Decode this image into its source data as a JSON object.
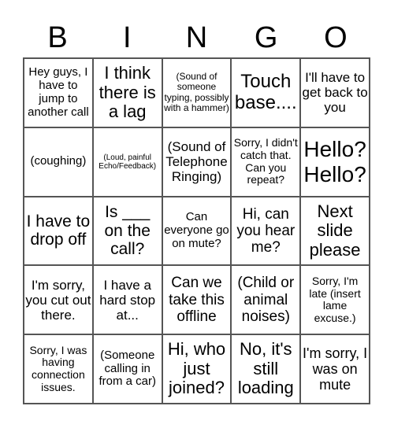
{
  "header": [
    "B",
    "I",
    "N",
    "G",
    "O"
  ],
  "cells": [
    "Hey guys, I have to jump to another call",
    "I think there is a lag",
    "(Sound of someone typing, possibly with a hammer)",
    "Touch base....",
    "I'll have to get back to you",
    "(coughing)",
    "(Loud, painful Echo/Feedback)",
    "(Sound of Telephone Ringing)",
    "Sorry, I didn't catch that. Can you repeat?",
    "Hello? Hello?",
    "I have to drop off",
    "Is ___ on the call?",
    "Can everyone go on mute?",
    "Hi, can you hear me?",
    "Next slide please",
    "I'm sorry, you cut out there.",
    "I have a hard stop at...",
    "Can we take this offline",
    "(Child or animal noises)",
    "Sorry, I'm late (insert lame excuse.)",
    "Sorry, I was having connection issues.",
    "(Someone calling in from a car)",
    "Hi, who just joined?",
    "No, it's still loading",
    "I'm sorry, I was on mute"
  ]
}
